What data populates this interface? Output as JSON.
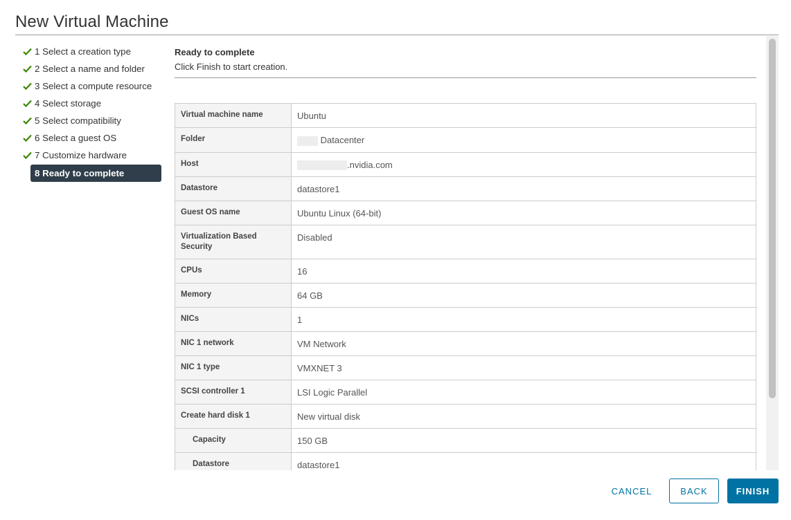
{
  "dialog": {
    "title": "New Virtual Machine"
  },
  "steps": [
    {
      "label": "1 Select a creation type",
      "done": true
    },
    {
      "label": "2 Select a name and folder",
      "done": true
    },
    {
      "label": "3 Select a compute resource",
      "done": true
    },
    {
      "label": "4 Select storage",
      "done": true
    },
    {
      "label": "5 Select compatibility",
      "done": true
    },
    {
      "label": "6 Select a guest OS",
      "done": true
    },
    {
      "label": "7 Customize hardware",
      "done": true
    },
    {
      "label": "8 Ready to complete",
      "done": false,
      "active": true
    }
  ],
  "content": {
    "heading": "Ready to complete",
    "subtitle": "Click Finish to start creation."
  },
  "summary": [
    {
      "label": "Virtual machine name",
      "value": "Ubuntu"
    },
    {
      "label": "Folder",
      "value": "Datacenter"
    },
    {
      "label": "Host",
      "value": ".nvidia.com"
    },
    {
      "label": "Datastore",
      "value": "datastore1"
    },
    {
      "label": "Guest OS name",
      "value": "Ubuntu Linux (64-bit)"
    },
    {
      "label": "Virtualization Based Security",
      "value": "Disabled"
    },
    {
      "label": "CPUs",
      "value": "16"
    },
    {
      "label": "Memory",
      "value": "64 GB"
    },
    {
      "label": "NICs",
      "value": "1"
    },
    {
      "label": "NIC 1 network",
      "value": "VM Network"
    },
    {
      "label": "NIC 1 type",
      "value": "VMXNET 3"
    },
    {
      "label": "SCSI controller 1",
      "value": "LSI Logic Parallel"
    },
    {
      "label": "Create hard disk 1",
      "value": "New virtual disk"
    },
    {
      "label": "Capacity",
      "value": "150 GB"
    },
    {
      "label": "Datastore",
      "value": "datastore1"
    }
  ],
  "buttons": {
    "cancel": "CANCEL",
    "back": "BACK",
    "finish": "FINISH"
  },
  "colors": {
    "accent": "#0072a3",
    "active_step_bg": "#2f3e4a",
    "check": "#3c8500"
  }
}
